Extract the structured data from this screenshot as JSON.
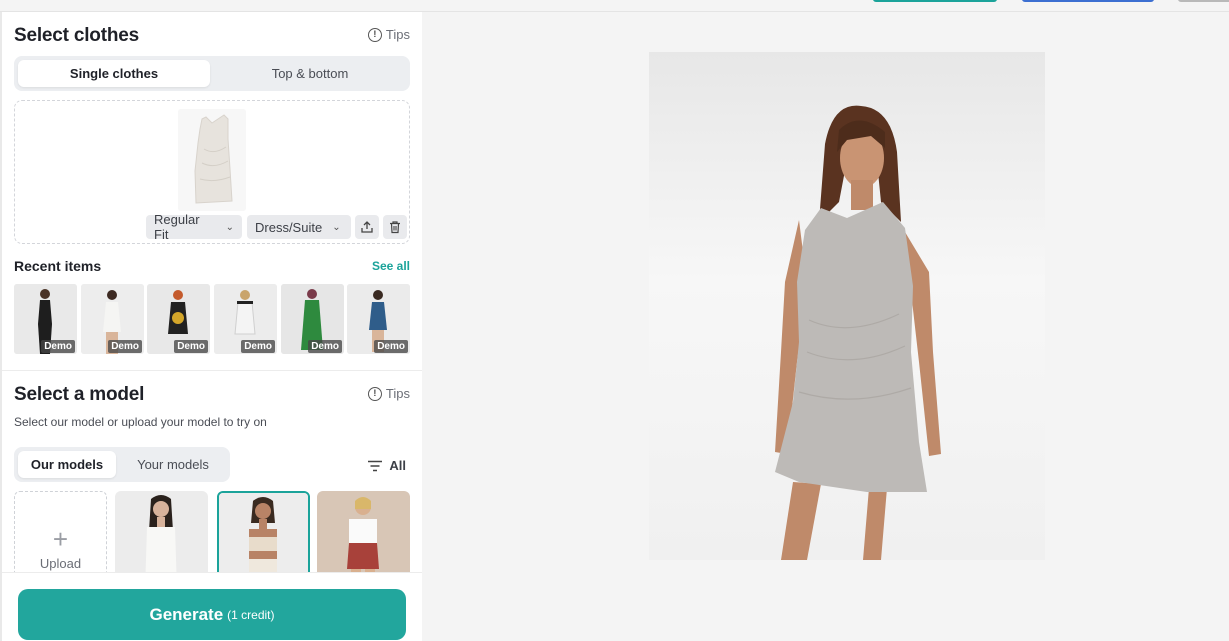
{
  "clothes": {
    "title": "Select clothes",
    "tips": "Tips",
    "tabs": [
      "Single clothes",
      "Top & bottom"
    ],
    "fit": "Regular Fit",
    "category": "Dress/Suite",
    "recent_title": "Recent items",
    "see_all": "See all",
    "demo_badge": "Demo",
    "recent_count": 6
  },
  "model": {
    "title": "Select a model",
    "tips": "Tips",
    "description": "Select our model or upload your model to try on",
    "tabs": [
      "Our models",
      "Your models"
    ],
    "filter": "All",
    "upload": "Upload"
  },
  "generate": {
    "label": "Generate",
    "credit": "(1 credit)"
  },
  "colors": {
    "accent": "#22a69d",
    "accent_text": "#1ba39a"
  },
  "icons": [
    "info-icon",
    "chevron-down-icon",
    "upload-icon",
    "trash-icon",
    "filter-icon",
    "plus-icon"
  ]
}
